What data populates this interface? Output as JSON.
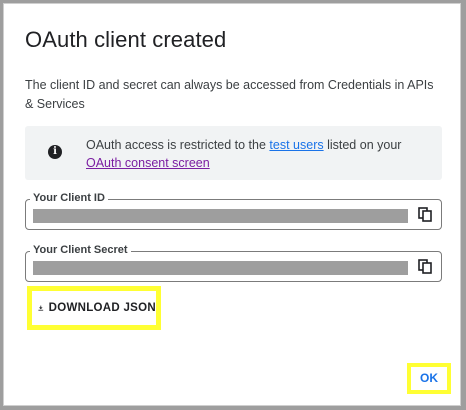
{
  "dialog": {
    "title": "OAuth client created",
    "description": "The client ID and secret can always be accessed from Credentials in APIs & Services"
  },
  "info": {
    "icon": "info-icon",
    "text_before": "OAuth access is restricted to the ",
    "test_users_link": "test users",
    "text_middle": " listed on your ",
    "consent_link": "OAuth consent screen"
  },
  "client_id": {
    "label": "Your Client ID",
    "copy_icon": "copy-icon"
  },
  "client_secret": {
    "label": "Your Client Secret",
    "copy_icon": "copy-icon"
  },
  "buttons": {
    "download_label": "DOWNLOAD JSON",
    "download_icon": "download-icon",
    "ok_label": "OK"
  },
  "colors": {
    "link_blue": "#1a73e8",
    "link_visited": "#7b1fa2",
    "highlight": "#ffff33",
    "redaction": "#9e9e9e"
  }
}
